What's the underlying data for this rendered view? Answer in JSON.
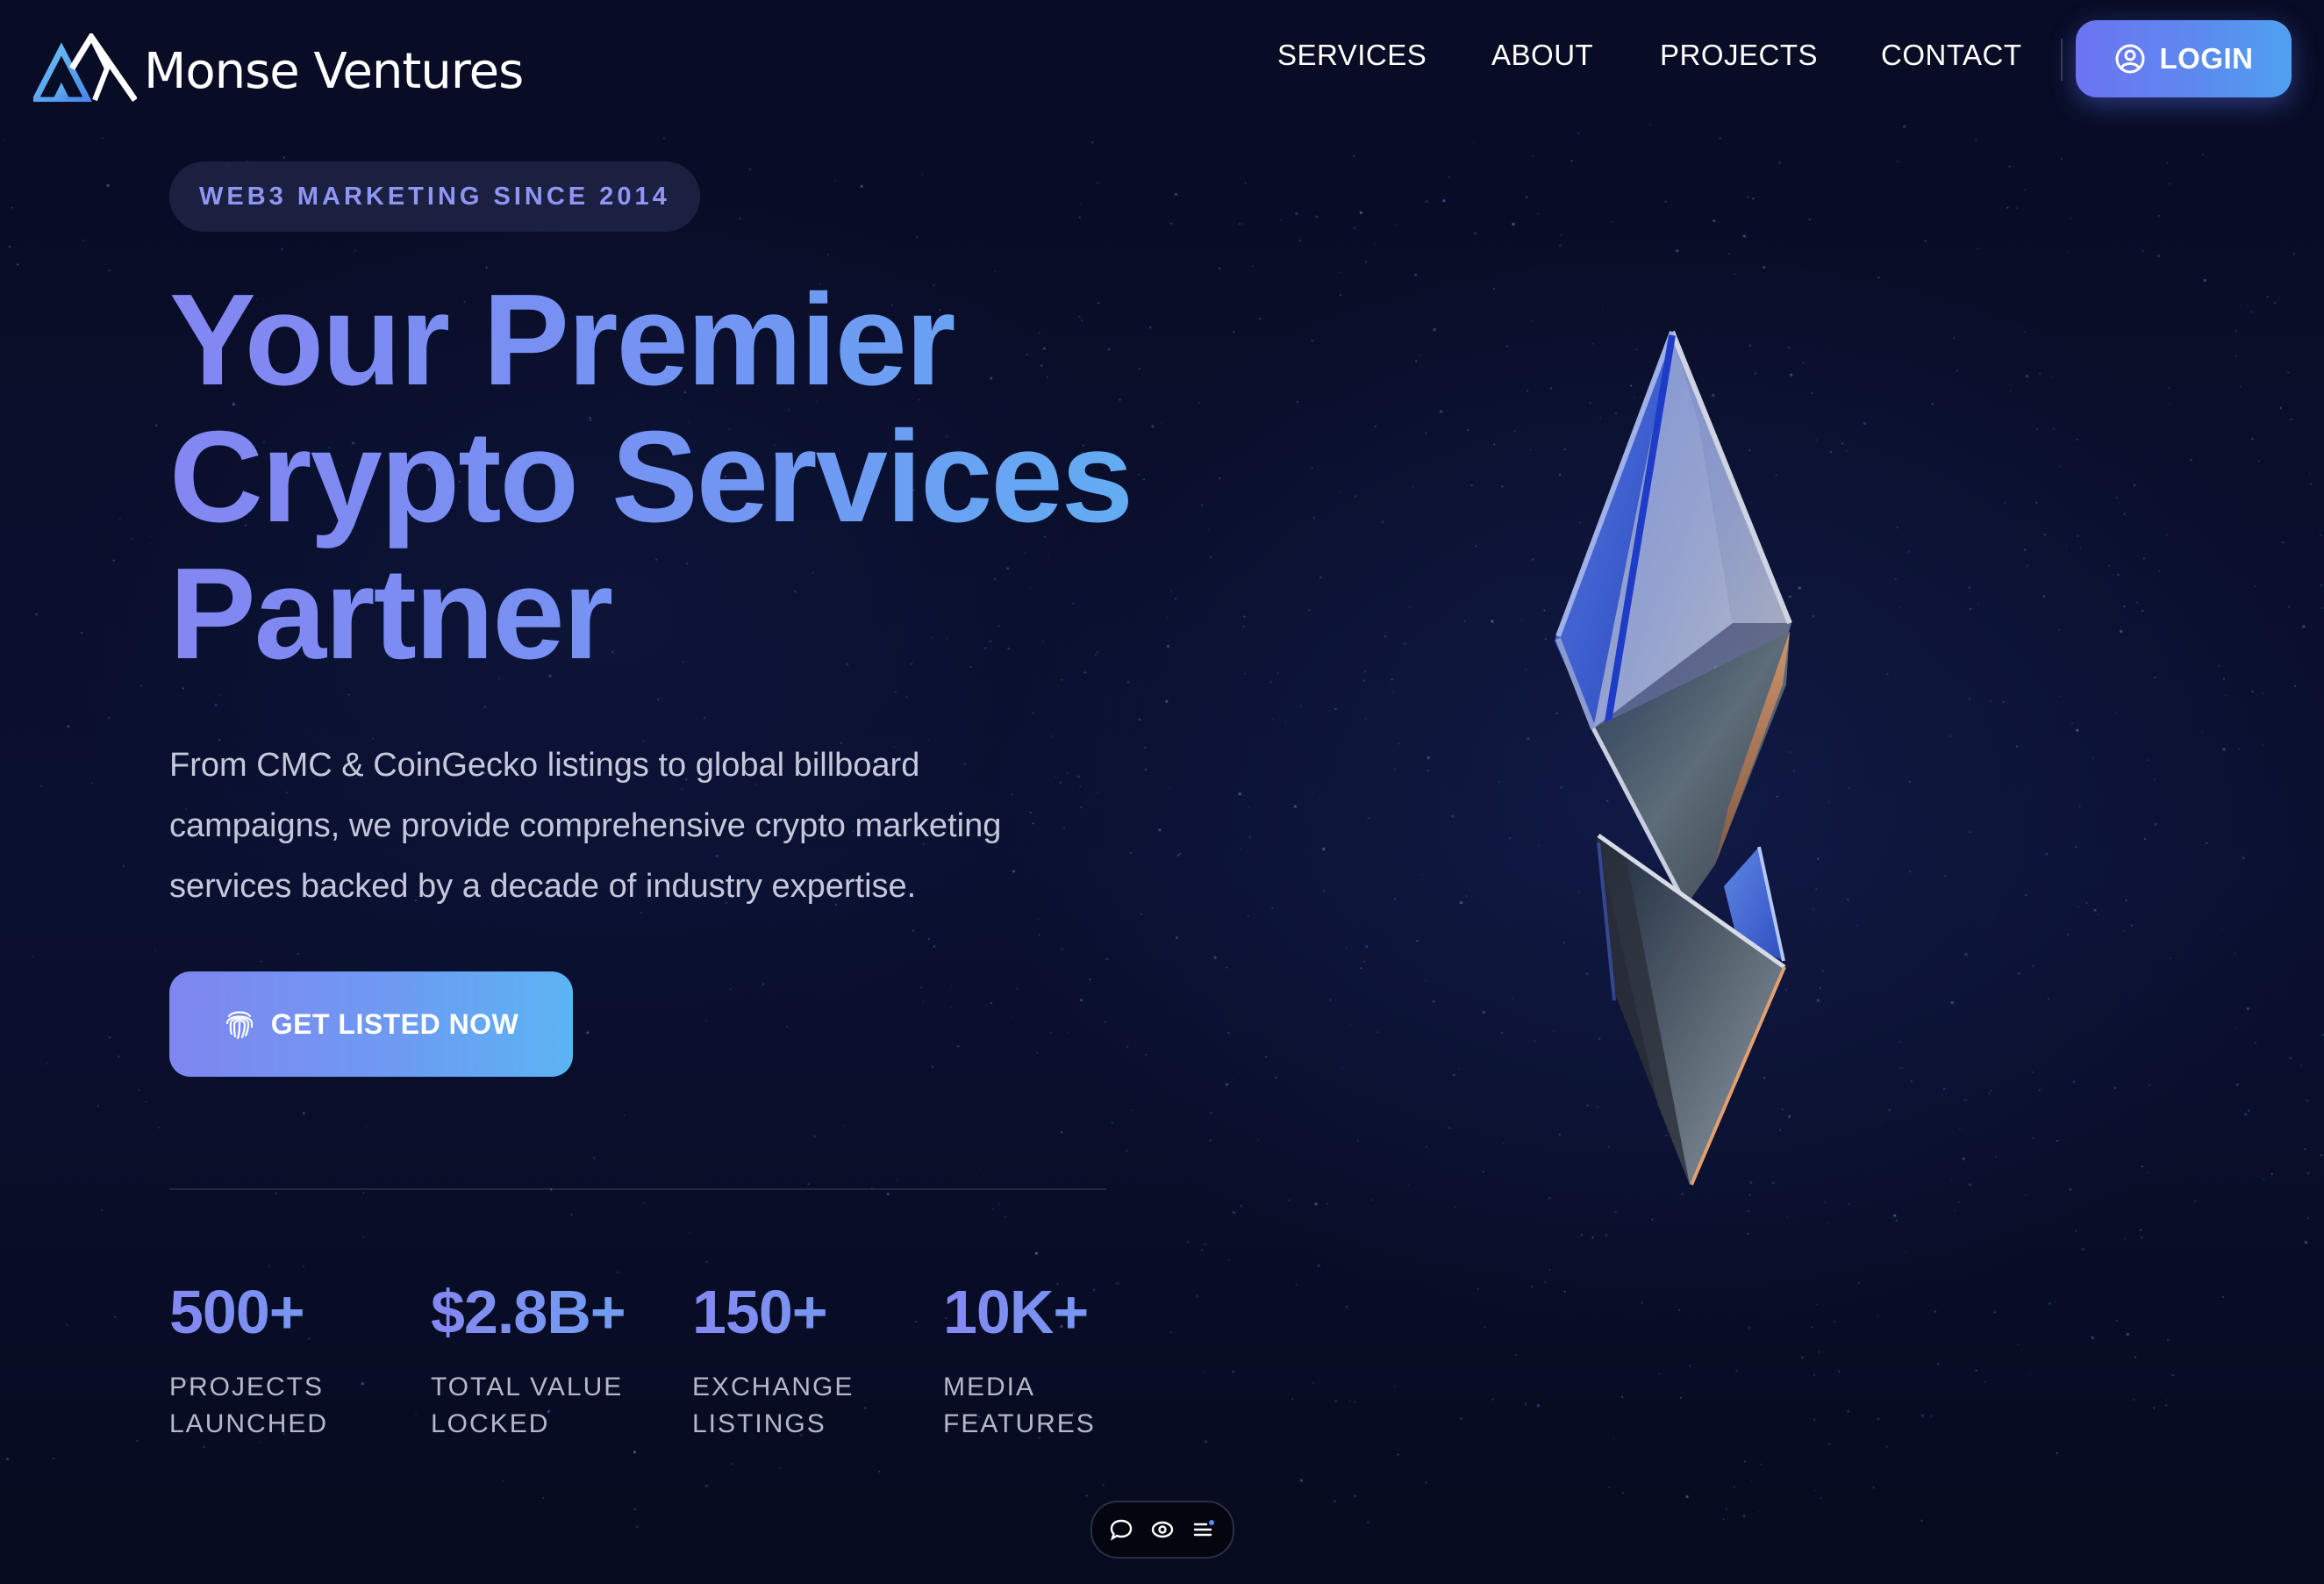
{
  "brand": {
    "name": "Monse Ventures"
  },
  "nav": {
    "links": [
      "SERVICES",
      "ABOUT",
      "PROJECTS",
      "CONTACT"
    ],
    "login_label": "LOGIN"
  },
  "hero": {
    "badge": "WEB3 MARKETING SINCE 2014",
    "title_lines": [
      "Your Premier",
      "Crypto Services",
      "Partner"
    ],
    "description": "From CMC & CoinGecko listings to global billboard campaigns, we provide comprehensive crypto marketing services backed by a decade of industry expertise.",
    "cta_label": "GET LISTED NOW"
  },
  "stats": [
    {
      "value": "500+",
      "label": "PROJECTS LAUNCHED"
    },
    {
      "value": "$2.8B+",
      "label": "TOTAL VALUE LOCKED"
    },
    {
      "value": "150+",
      "label": "EXCHANGE LISTINGS"
    },
    {
      "value": "10K+",
      "label": "MEDIA FEATURES"
    }
  ],
  "bottom_toolbar": {
    "icons": [
      "chat-icon",
      "eye-icon",
      "menu-list-icon"
    ]
  },
  "colors": {
    "background": "#070c22",
    "accent_gradient_start": "#7f86f0",
    "accent_gradient_end": "#5bb4f3",
    "badge_text": "#8f95f3",
    "body_text": "#c4c8da"
  }
}
